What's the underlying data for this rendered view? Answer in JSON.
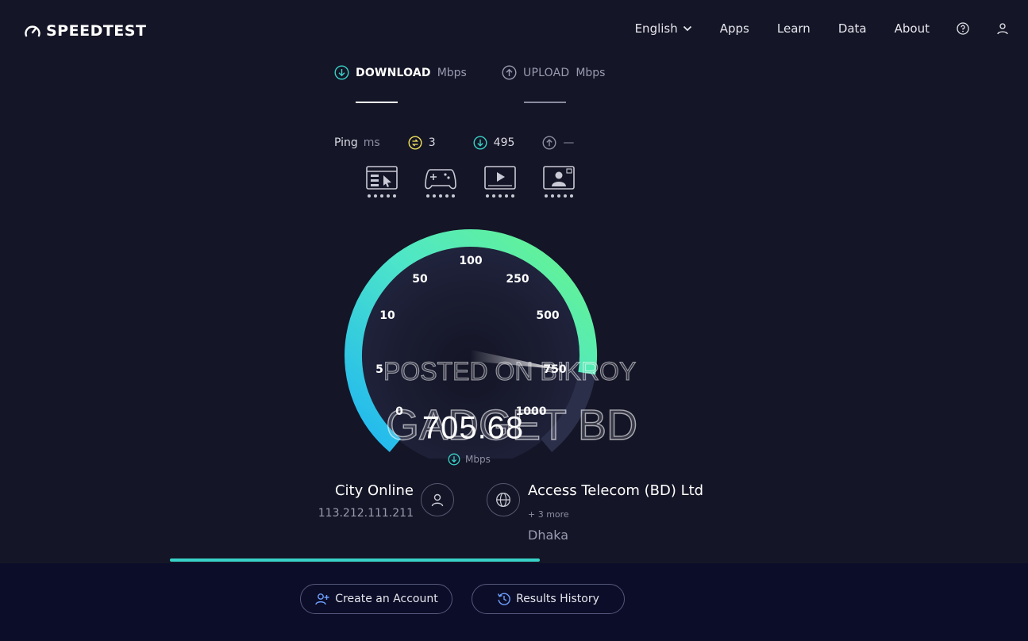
{
  "header": {
    "brand": "SPEEDTEST",
    "nav": {
      "language": "English",
      "apps": "Apps",
      "learn": "Learn",
      "data": "Data",
      "about": "About"
    }
  },
  "tabs": {
    "download": {
      "label": "DOWNLOAD",
      "unit": "Mbps"
    },
    "upload": {
      "label": "UPLOAD",
      "unit": "Mbps"
    }
  },
  "ping": {
    "label": "Ping",
    "unit": "ms",
    "idle": "3",
    "download": "495",
    "upload": "—"
  },
  "activities": [
    {
      "icon": "browsing-icon",
      "dots": 5
    },
    {
      "icon": "gaming-icon",
      "dots": 5
    },
    {
      "icon": "streaming-icon",
      "dots": 5
    },
    {
      "icon": "video-call-icon",
      "dots": 5
    }
  ],
  "gauge": {
    "ticks": [
      "0",
      "5",
      "10",
      "50",
      "100",
      "250",
      "500",
      "750",
      "1000"
    ],
    "value": "705.68",
    "unit": "Mbps",
    "needle_value": 705.68,
    "colors": {
      "start": "#1fb5f2",
      "mid": "#4ee6c8",
      "end": "#68f58a"
    }
  },
  "watermark": {
    "line1": "POSTED ON BIKROY",
    "line2": "GADGET BD"
  },
  "provider": {
    "isp": "City Online",
    "ip": "113.212.111.211",
    "server": "Access Telecom (BD) Ltd",
    "more": "+ 3 more",
    "city": "Dhaka"
  },
  "progress": {
    "fraction": 0.36,
    "color": "#38d2c8"
  },
  "footer": {
    "create_account": "Create an Account",
    "results_history": "Results History"
  }
}
